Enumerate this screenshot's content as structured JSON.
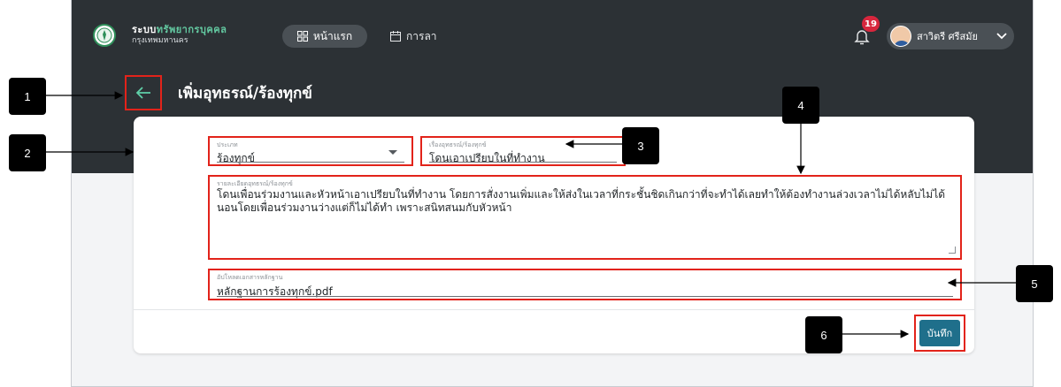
{
  "header": {
    "brand_prefix": "ระบบ",
    "brand_accent": "ทรัพยากรบุคคล",
    "brand_sub": "กรุงเทพมหานคร",
    "nav_home": "หน้าแรก",
    "nav_leave": "การลา",
    "notification_count": "19",
    "user_name": "สาวิตรี ศรีสมัย"
  },
  "page": {
    "title": "เพิ่มอุทธรณ์/ร้องทุกข์"
  },
  "form": {
    "type_label": "ประเภท",
    "type_value": "ร้องทุกข์",
    "subject_label": "เรื่องอุทธรณ์/ร้องทุกข์",
    "subject_value": "โดนเอาเปรียบในที่ทำงาน",
    "detail_label": "รายละเอียดอุทธรณ์/ร้องทุกข์",
    "detail_value": "โดนเพื่อนร่วมงานและหัวหน้าเอาเปรียบในที่ทำงาน โดยการสั่งงานเพิ่มและให้ส่งในเวลาที่กระชั้นชิดเกินกว่าที่จะทำได้เลยทำให้ต้องทำงานล่วงเวลาไม่ได้หลับไม่ได้นอนโดยเพื่อนร่วมงานว่างแต่ก็ไม่ได้ทำ เพราะสนิทสนมกับหัวหน้า",
    "upload_label": "อัปโหลดเอกสารหลักฐาน",
    "upload_value": "หลักฐานการร้องทุกข์.pdf",
    "save_label": "บันทึก"
  },
  "callouts": [
    "1",
    "2",
    "3",
    "4",
    "5",
    "6"
  ],
  "colors": {
    "header_bg": "#2c3135",
    "accent": "#5fd0a8",
    "highlight": "#e2231a",
    "save_button": "#1f6f8b",
    "badge": "#d7263d"
  }
}
